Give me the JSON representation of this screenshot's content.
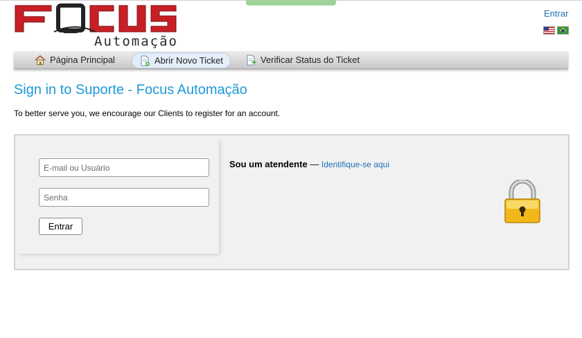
{
  "logo": {
    "main_text": "FOCUS",
    "sub_text": "Automação"
  },
  "header": {
    "login_link": "Entrar"
  },
  "flags": [
    {
      "name": "us-flag-icon"
    },
    {
      "name": "br-flag-icon"
    }
  ],
  "nav": {
    "items": [
      {
        "label": "Página Principal",
        "icon": "home-icon"
      },
      {
        "label": "Abrir Novo Ticket",
        "icon": "new-ticket-icon",
        "active": true
      },
      {
        "label": "Verificar Status do Ticket",
        "icon": "ticket-status-icon"
      }
    ]
  },
  "page": {
    "title": "Sign in to Suporte - Focus Automação",
    "intro": "To better serve you, we encourage our Clients to register for an account."
  },
  "login": {
    "username_placeholder": "E-mail ou Usuário",
    "password_placeholder": "Senha",
    "submit_label": "Entrar"
  },
  "agent": {
    "prefix": "Sou um atendente",
    "separator": " — ",
    "link": "Identifique-se aqui"
  },
  "colors": {
    "accent": "#1d9ad8",
    "link": "#1d6fb8",
    "logo_red": "#c81f26"
  }
}
